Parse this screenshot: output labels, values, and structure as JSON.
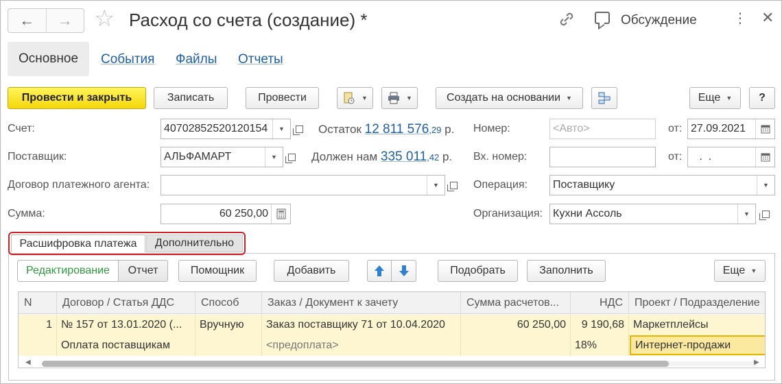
{
  "window": {
    "title": "Расход со счета (создание) *",
    "discussion_label": "Обсуждение"
  },
  "section_tabs": {
    "active": "Основное",
    "links": [
      "События",
      "Файлы",
      "Отчеты"
    ]
  },
  "toolbar": {
    "post_and_close": "Провести и закрыть",
    "save": "Записать",
    "post": "Провести",
    "create_based_on": "Создать на основании",
    "more": "Еще",
    "help": "?"
  },
  "form": {
    "account_label": "Счет:",
    "account_value": "40702852520120154",
    "balance_label": "Остаток",
    "balance_amount": "12 811 576",
    "balance_kop": ",29",
    "balance_currency": "р.",
    "supplier_label": "Поставщик:",
    "supplier_value": "АЛЬФАМАРТ",
    "debt_label": "Должен нам",
    "debt_amount": "335 011",
    "debt_kop": ",42",
    "debt_currency": "р.",
    "agent_contract_label": "Договор платежного агента:",
    "agent_contract_value": "",
    "sum_label": "Сумма:",
    "sum_value": "60 250,00",
    "number_label": "Номер:",
    "number_placeholder": "<Авто>",
    "date_from_label": "от:",
    "date_value": "27.09.2021",
    "incoming_number_label": "Вх. номер:",
    "incoming_number_value": "",
    "incoming_date_label": "от:",
    "incoming_date_value": " .  .",
    "operation_label": "Операция:",
    "operation_value": "Поставщику",
    "organization_label": "Организация:",
    "organization_value": "Кухни Ассоль"
  },
  "inner_tabs": {
    "active": "Расшифровка платежа",
    "other": "Дополнительно"
  },
  "tab_toolbar": {
    "mode_edit": "Редактирование",
    "mode_report": "Отчет",
    "assistant": "Помощник",
    "add": "Добавить",
    "pick": "Подобрать",
    "fill": "Заполнить",
    "more": "Еще"
  },
  "table": {
    "columns": [
      "N",
      "Договор / Статья ДДС",
      "Способ",
      "Заказ / Документ к зачету",
      "Сумма расчетов...",
      "НДС",
      "Проект / Подразделение"
    ],
    "rows": [
      {
        "n": "1",
        "contract": "№ 157 от 13.01.2020 (...",
        "cash_flow_item": "Оплата поставщикам",
        "method": "Вручную",
        "order": "Заказ поставщику 71 от 10.04.2020",
        "offset_doc": "<предоплата>",
        "amount": "60 250,00",
        "vat": "9 190,68",
        "vat_rate": "18%",
        "project": "Маркетплейсы",
        "department": "Интернет-продажи"
      }
    ]
  }
}
